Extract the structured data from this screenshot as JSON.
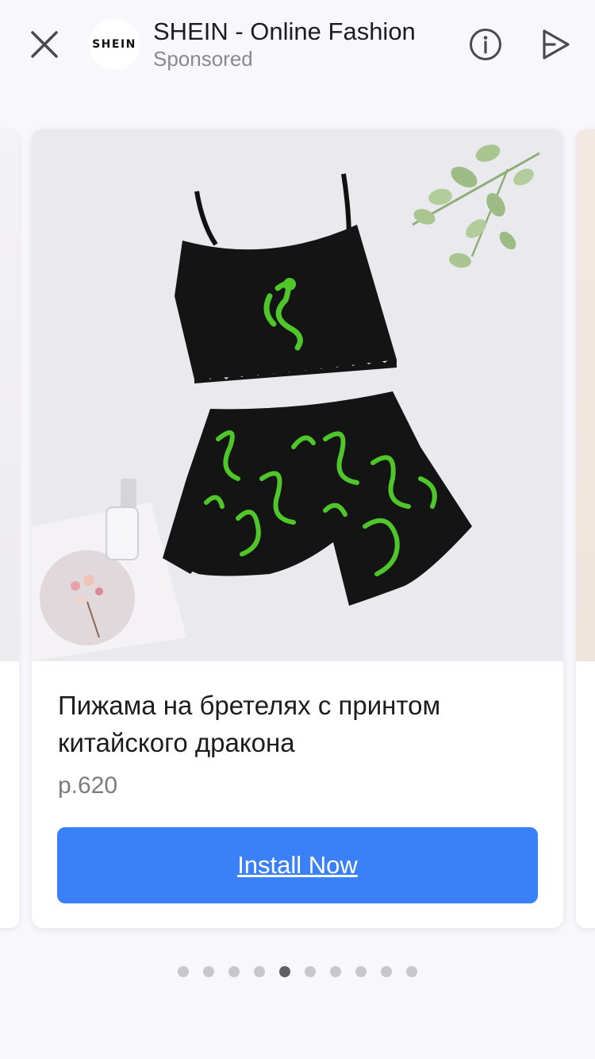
{
  "header": {
    "logo_text": "SHEIN",
    "title": "SHEIN - Online Fashion",
    "subtitle": "Sponsored",
    "close_icon": "close-icon",
    "info_icon": "info-icon",
    "share_icon": "share-arrow-icon"
  },
  "card": {
    "title": "Пижама на бретелях с принтом китайского дракона",
    "price": "р.620",
    "cta_label": "Install Now",
    "image_alt": "black cami top and dragon print shorts pajama set"
  },
  "carousel": {
    "page_count": 10,
    "active_index": 4
  },
  "colors": {
    "accent": "#3a80f8",
    "dragon_green": "#4fc62a"
  }
}
